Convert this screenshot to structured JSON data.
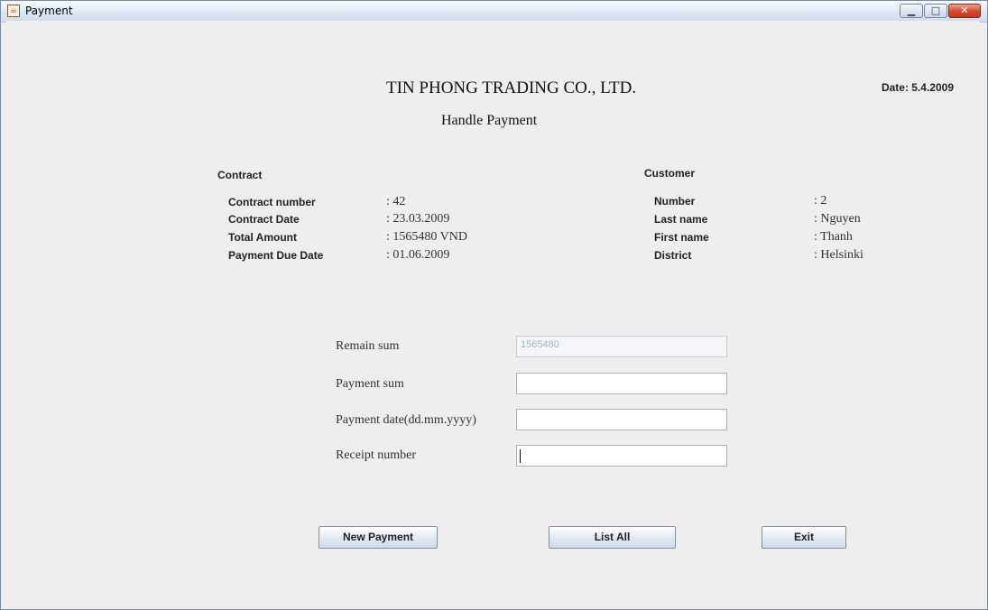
{
  "window": {
    "title": "Payment"
  },
  "header": {
    "company": "TIN PHONG TRADING CO., LTD.",
    "date_label": "Date: 5.4.2009",
    "subtitle": "Handle Payment"
  },
  "contract": {
    "section_title": "Contract",
    "rows": [
      {
        "label": "Contract number",
        "value": ": 42"
      },
      {
        "label": "Contract Date",
        "value": ": 23.03.2009"
      },
      {
        "label": "Total Amount",
        "value": ": 1565480 VND"
      },
      {
        "label": "Payment Due Date",
        "value": ": 01.06.2009"
      }
    ]
  },
  "customer": {
    "section_title": "Customer",
    "rows": [
      {
        "label": "Number",
        "value": ": 2"
      },
      {
        "label": "Last name",
        "value": ": Nguyen"
      },
      {
        "label": "First name",
        "value": ": Thanh"
      },
      {
        "label": "District",
        "value": ": Helsinki"
      }
    ]
  },
  "form": {
    "remain_sum": {
      "label": "Remain sum",
      "value": "1565480"
    },
    "payment_sum": {
      "label": "Payment sum",
      "value": ""
    },
    "payment_date": {
      "label": "Payment date(dd.mm.yyyy)",
      "value": ""
    },
    "receipt_number": {
      "label": "Receipt number",
      "value": ""
    }
  },
  "buttons": {
    "new_payment": "New Payment",
    "list_all": "List All",
    "exit": "Exit"
  },
  "icons": {
    "app": "java-coffee-cup-icon",
    "minimize": "minimize-icon",
    "maximize": "maximize-icon",
    "close": "close-icon"
  }
}
